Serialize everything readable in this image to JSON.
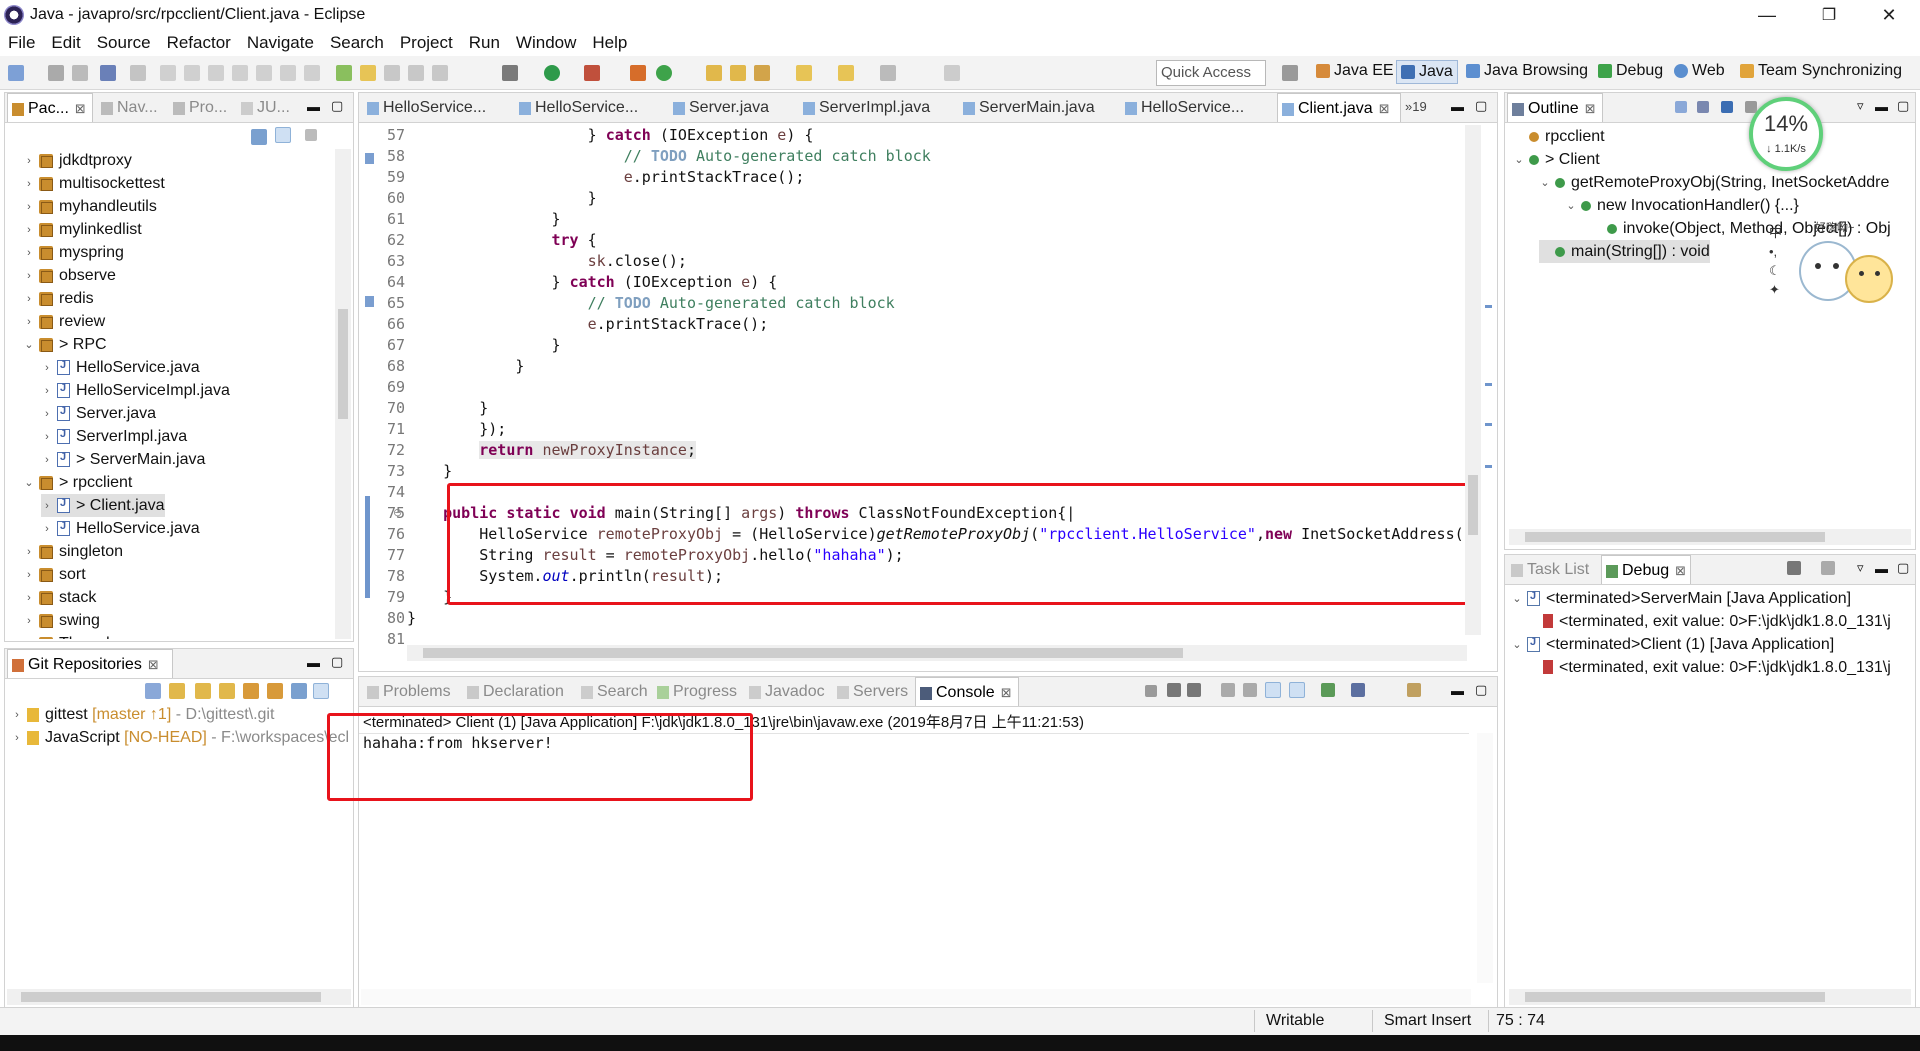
{
  "window": {
    "title": "Java - javapro/src/rpcclient/Client.java - Eclipse",
    "minimize": "—",
    "restore": "❐",
    "close": "✕"
  },
  "menu": [
    "File",
    "Edit",
    "Source",
    "Refactor",
    "Navigate",
    "Search",
    "Project",
    "Run",
    "Window",
    "Help"
  ],
  "quick_access": "Quick Access",
  "perspectives": [
    "Java EE",
    "Java",
    "Java Browsing",
    "Debug",
    "Web",
    "Team Synchronizing"
  ],
  "left_top": {
    "tabs": [
      "Pac...",
      "Nav...",
      "Pro...",
      "JU..."
    ],
    "tree": [
      {
        "label": "jdkdtproxy",
        "type": "project",
        "depth": 0,
        "twisty": "›"
      },
      {
        "label": "multisockettest",
        "type": "project",
        "depth": 0,
        "twisty": "›"
      },
      {
        "label": "myhandleutils",
        "type": "project",
        "depth": 0,
        "twisty": "›"
      },
      {
        "label": "mylinkedlist",
        "type": "project",
        "depth": 0,
        "twisty": "›"
      },
      {
        "label": "myspring",
        "type": "project",
        "depth": 0,
        "twisty": "›"
      },
      {
        "label": "observe",
        "type": "project",
        "depth": 0,
        "twisty": "›"
      },
      {
        "label": "redis",
        "type": "project",
        "depth": 0,
        "twisty": "›"
      },
      {
        "label": "review",
        "type": "project",
        "depth": 0,
        "twisty": "›"
      },
      {
        "label": "> RPC",
        "type": "project",
        "depth": 0,
        "twisty": "⌄"
      },
      {
        "label": "HelloService.java",
        "type": "java",
        "depth": 1,
        "twisty": "›"
      },
      {
        "label": "HelloServiceImpl.java",
        "type": "java",
        "depth": 1,
        "twisty": "›"
      },
      {
        "label": "Server.java",
        "type": "java",
        "depth": 1,
        "twisty": "›"
      },
      {
        "label": "ServerImpl.java",
        "type": "java",
        "depth": 1,
        "twisty": "›"
      },
      {
        "label": "> ServerMain.java",
        "type": "java",
        "depth": 1,
        "twisty": "›"
      },
      {
        "label": "> rpcclient",
        "type": "package",
        "depth": 0,
        "twisty": "⌄"
      },
      {
        "label": "> Client.java",
        "type": "java",
        "depth": 1,
        "twisty": "›",
        "selected": true
      },
      {
        "label": "HelloService.java",
        "type": "java",
        "depth": 1,
        "twisty": "›"
      },
      {
        "label": "singleton",
        "type": "project",
        "depth": 0,
        "twisty": "›"
      },
      {
        "label": "sort",
        "type": "project",
        "depth": 0,
        "twisty": "›"
      },
      {
        "label": "stack",
        "type": "project",
        "depth": 0,
        "twisty": "›"
      },
      {
        "label": "swing",
        "type": "project",
        "depth": 0,
        "twisty": "›"
      },
      {
        "label": "Thread",
        "type": "project",
        "depth": 0,
        "twisty": "›"
      }
    ]
  },
  "git": {
    "tab": "Git Repositories",
    "repos": [
      {
        "name": "gittest",
        "branch": "[master ↑1]",
        "path": "- D:\\gittest\\.git"
      },
      {
        "name": "JavaScript",
        "branch": "[NO-HEAD]",
        "path": "- F:\\workspaces\\ecl"
      }
    ]
  },
  "editor": {
    "tabs": [
      "HelloService...",
      "HelloService...",
      "Server.java",
      "ServerImpl.java",
      "ServerMain.java",
      "HelloService...",
      "Client.java"
    ],
    "overflow": "»19",
    "line_numbers": [
      "57",
      "58",
      "59",
      "60",
      "61",
      "62",
      "63",
      "64",
      "65",
      "66",
      "67",
      "68",
      "69",
      "70",
      "71",
      "72",
      "73",
      "74",
      "75",
      "76",
      "77",
      "78",
      "79",
      "80",
      "81"
    ]
  },
  "console": {
    "tabs": [
      "Problems",
      "Declaration",
      "Search",
      "Progress",
      "Javadoc",
      "Servers",
      "Console"
    ],
    "header": "<terminated> Client (1) [Java Application] F:\\jdk\\jdk1.8.0_131\\jre\\bin\\javaw.exe (2019年8月7日 上午11:21:53)",
    "output": "hahaha:from hkserver!"
  },
  "outline": {
    "tab": "Outline",
    "items": [
      {
        "label": "rpcclient",
        "depth": 0
      },
      {
        "label": "Client",
        "depth": 0,
        "prefix": "> "
      },
      {
        "label": "getRemoteProxyObj(String, InetSocketAddre",
        "depth": 1
      },
      {
        "label": "new InvocationHandler() {...}",
        "depth": 2
      },
      {
        "label": "invoke(Object, Method, Object[]) : Obj",
        "depth": 3
      },
      {
        "label": "main(String[]) : void",
        "depth": 1,
        "selected": true
      }
    ],
    "net_percent": "14%",
    "net_speed": "↓ 1.1K/s",
    "sticker_text": "好嗨呦~",
    "sticker_side": [
      "中",
      "•,",
      "☾",
      "✦"
    ]
  },
  "debug": {
    "tabs": [
      "Task List",
      "Debug"
    ],
    "items": [
      "<terminated>ServerMain [Java Application]",
      "<terminated, exit value: 0>F:\\jdk\\jdk1.8.0_131\\j",
      "<terminated>Client (1) [Java Application]",
      "<terminated, exit value: 0>F:\\jdk\\jdk1.8.0_131\\j"
    ]
  },
  "status": {
    "writable": "Writable",
    "insert": "Smart Insert",
    "position": "75 : 74"
  }
}
